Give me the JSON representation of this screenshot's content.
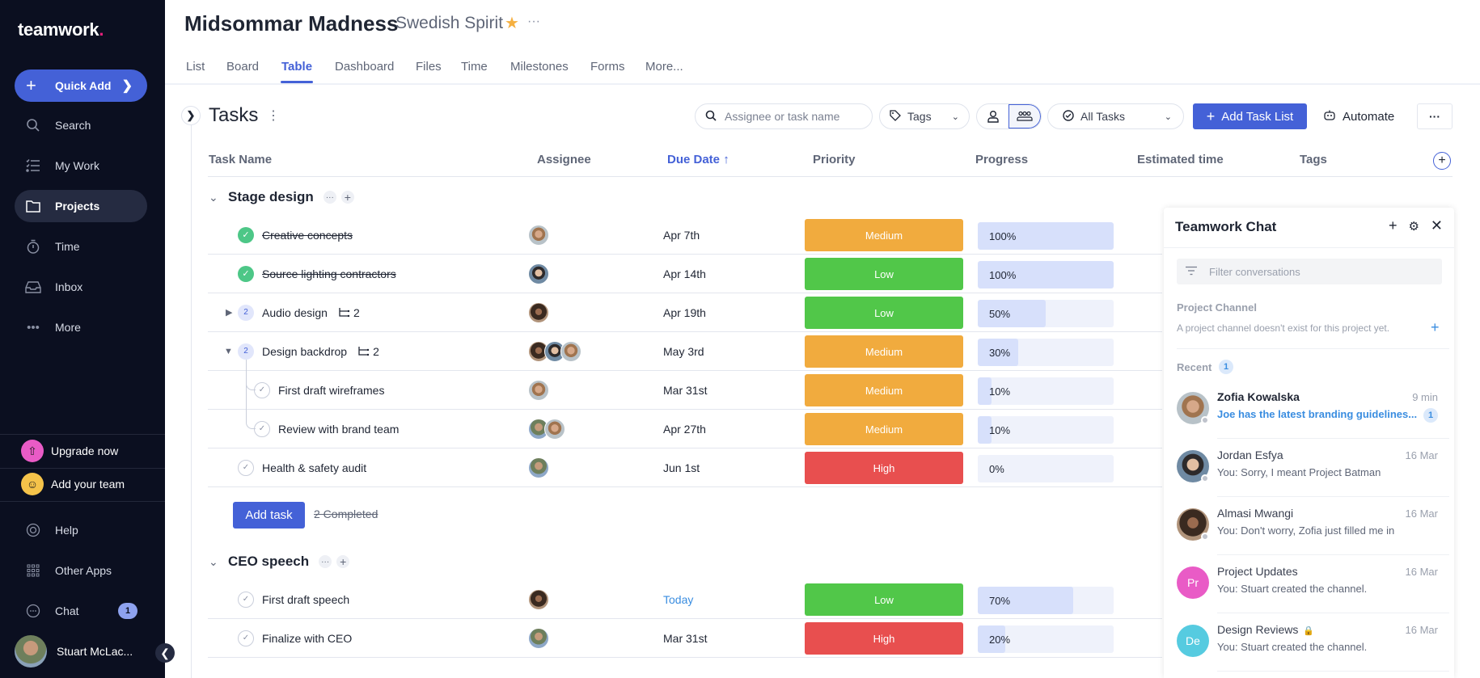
{
  "sidebar": {
    "logo": "teamwork",
    "quick_add": "Quick Add",
    "nav": [
      {
        "label": "Search",
        "icon": "search-icon"
      },
      {
        "label": "My Work",
        "icon": "checklist-icon"
      },
      {
        "label": "Projects",
        "icon": "folder-icon",
        "active": true
      },
      {
        "label": "Time",
        "icon": "stopwatch-icon"
      },
      {
        "label": "Inbox",
        "icon": "inbox-icon"
      },
      {
        "label": "More",
        "icon": "more-icon"
      }
    ],
    "upgrade": "Upgrade now",
    "add_team": "Add your team",
    "help": "Help",
    "other_apps": "Other Apps",
    "chat": "Chat",
    "chat_badge": "1",
    "user_name": "Stuart McLac..."
  },
  "header": {
    "project_title": "Midsommar Madness",
    "project_subtitle": "Swedish Spirit",
    "tabs": [
      "List",
      "Board",
      "Table",
      "Dashboard",
      "Files",
      "Time",
      "Milestones",
      "Forms",
      "More..."
    ],
    "active_tab": "Table"
  },
  "toolbar": {
    "title": "Tasks",
    "search_placeholder": "Assignee or task name",
    "tags_label": "Tags",
    "filter_label": "All Tasks",
    "add_task_list": "Add Task List",
    "automate": "Automate"
  },
  "table": {
    "columns": [
      "Task Name",
      "Assignee",
      "Due Date",
      "Priority",
      "Progress",
      "Estimated time",
      "Tags"
    ],
    "sorted_column": "Due Date",
    "groups": [
      {
        "name": "Stage design",
        "tasks": [
          {
            "name": "Creative concepts",
            "done": true,
            "assignees": [
              "zofia"
            ],
            "due": "Apr 7th",
            "priority": "Medium",
            "progress": 100
          },
          {
            "name": "Source lighting contractors",
            "done": true,
            "assignees": [
              "jordan"
            ],
            "due": "Apr 14th",
            "priority": "Low",
            "progress": 100
          },
          {
            "name": "Audio design",
            "done": false,
            "subtask_count": "2",
            "subtasks_label": "2",
            "collapsed": true,
            "assignees": [
              "almasi"
            ],
            "due": "Apr 19th",
            "priority": "Low",
            "progress": 50
          },
          {
            "name": "Design backdrop",
            "done": false,
            "subtask_count": "2",
            "subtasks_label": "2",
            "collapsed": false,
            "assignees": [
              "almasi",
              "jordan",
              "zofia"
            ],
            "due": "May 3rd",
            "priority": "Medium",
            "progress": 30
          },
          {
            "name": "First draft wireframes",
            "done": false,
            "subtask": true,
            "assignees": [
              "zofia"
            ],
            "due": "Mar 31st",
            "priority": "Medium",
            "progress": 10
          },
          {
            "name": "Review with brand team",
            "done": false,
            "subtask": true,
            "assignees": [
              "stuart",
              "zofia"
            ],
            "due": "Apr 27th",
            "priority": "Medium",
            "progress": 10
          },
          {
            "name": "Health & safety audit",
            "done": false,
            "assignees": [
              "stuart"
            ],
            "due": "Jun 1st",
            "priority": "High",
            "progress": 0
          }
        ],
        "add_task": "Add task",
        "completed_label": "2 Completed"
      },
      {
        "name": "CEO speech",
        "tasks": [
          {
            "name": "First draft speech",
            "done": false,
            "assignees": [
              "almasi"
            ],
            "due": "Today",
            "due_today": true,
            "priority": "Low",
            "progress": 70
          },
          {
            "name": "Finalize with CEO",
            "done": false,
            "assignees": [
              "stuart"
            ],
            "due": "Mar 31st",
            "priority": "High",
            "progress": 20
          }
        ]
      }
    ],
    "priority_colors": {
      "Low": "#51c749",
      "Medium": "#f1ab3e",
      "High": "#e84f4f"
    }
  },
  "chat": {
    "title": "Teamwork Chat",
    "filter_placeholder": "Filter conversations",
    "project_channel_label": "Project Channel",
    "project_channel_note": "A project channel doesn't exist for this project yet.",
    "recent_label": "Recent",
    "recent_count": "1",
    "conversations": [
      {
        "name": "Zofia Kowalska",
        "time": "9 min",
        "message": "Joe has the latest branding guidelines...",
        "unread": "1",
        "avatar": "zofia"
      },
      {
        "name": "Jordan Esfya",
        "time": "16 Mar",
        "message": "You: Sorry, I meant Project Batman",
        "avatar": "jordan"
      },
      {
        "name": "Almasi Mwangi",
        "time": "16 Mar",
        "message": "You: Don't worry, Zofia just filled me in",
        "avatar": "almasi"
      },
      {
        "name": "Project Updates",
        "time": "16 Mar",
        "message": "You: Stuart created the channel.",
        "initials": "Pr",
        "color": "#e95bc6"
      },
      {
        "name": "Design Reviews",
        "time": "16 Mar",
        "message": "You: Stuart created the channel.",
        "initials": "De",
        "color": "#56cbe0",
        "private": true
      }
    ]
  }
}
